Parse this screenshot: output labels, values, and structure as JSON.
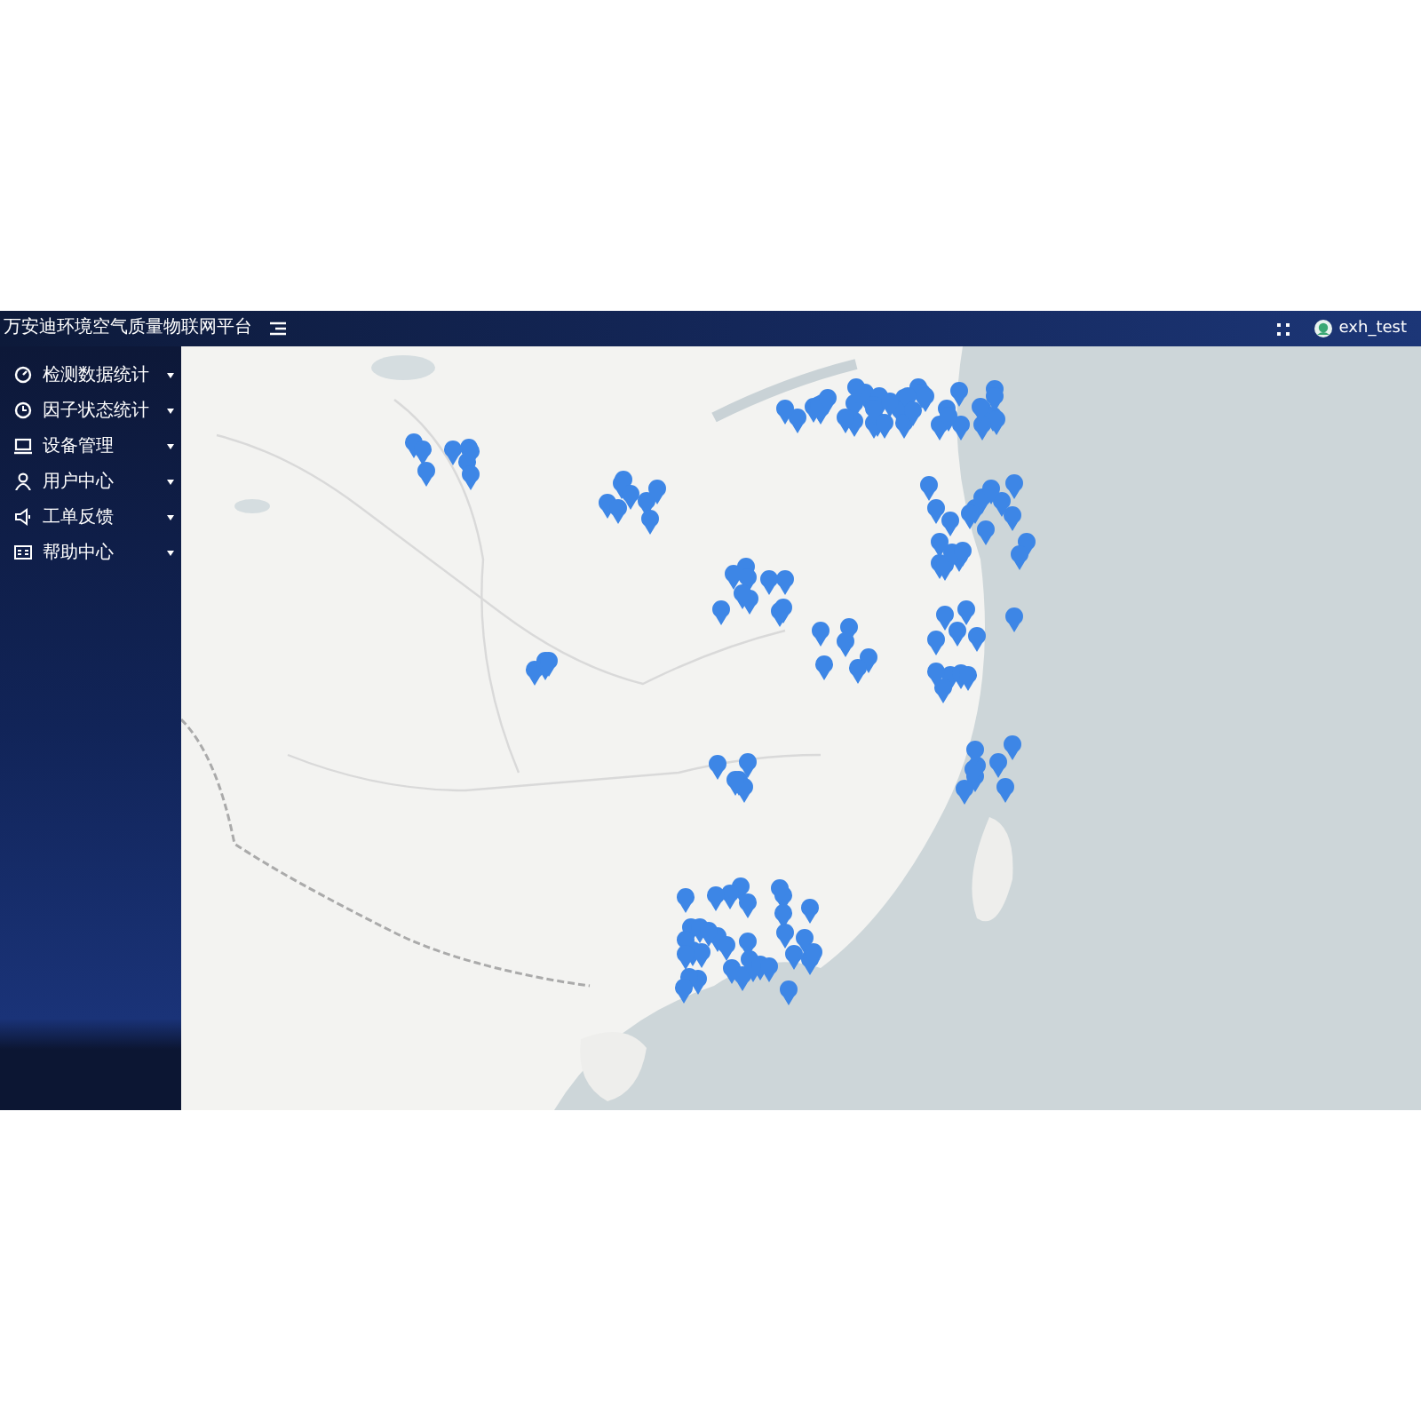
{
  "header": {
    "title": "万安迪环境空气质量物联网平台",
    "user": "exh_test"
  },
  "sidebar": {
    "items": [
      {
        "label": "检测数据统计"
      },
      {
        "label": "因子状态统计"
      },
      {
        "label": "设备管理"
      },
      {
        "label": "用户中心"
      },
      {
        "label": "工单反馈"
      },
      {
        "label": "帮助中心"
      }
    ]
  }
}
